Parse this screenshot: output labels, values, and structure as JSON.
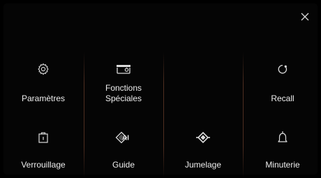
{
  "dialog": {
    "close_icon": "close-icon"
  },
  "menu": {
    "items": [
      {
        "label": "Paramètres",
        "icon": "gear-icon"
      },
      {
        "label": "Fonctions\nSpéciales",
        "icon": "special-functions-icon"
      },
      {
        "label": "Recall",
        "icon": "recall-icon"
      },
      {
        "label": "Verrouillage",
        "icon": "lock-icon"
      },
      {
        "label": "Guide",
        "icon": "ai-guide-icon",
        "icon_text": "AI"
      },
      {
        "label": "Jumelage",
        "icon": "pairing-icon"
      },
      {
        "label": "Minuterie",
        "icon": "timer-bell-icon"
      }
    ]
  },
  "colors": {
    "background": "#000000",
    "text": "#ededed",
    "divider": "#8c5037"
  }
}
